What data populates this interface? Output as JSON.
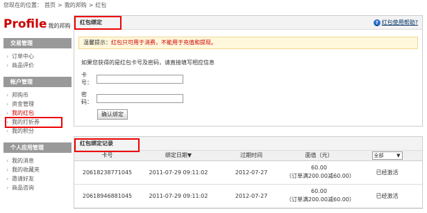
{
  "breadcrumb": {
    "prefix": "您现在的位置：",
    "items": [
      "首页",
      "我的邦购",
      "红包"
    ],
    "separator": ">"
  },
  "sidebar": {
    "title": "Profile",
    "subtitle": "我的邦购",
    "sections": [
      {
        "heading": "交易管理",
        "items": [
          "订单中心",
          "商品评价"
        ]
      },
      {
        "heading": "帐户管理",
        "items": [
          "邦购币",
          "资金管理",
          "我的红包",
          "我的打折券",
          "我的积分"
        ]
      },
      {
        "heading": "个人应用管理",
        "items": [
          "我的消息",
          "我的收藏夹",
          "邀请好友",
          "商品咨询"
        ]
      }
    ],
    "active_item": "我的红包"
  },
  "bind_panel": {
    "title": "红包绑定",
    "help_label": "红包使用帮助?",
    "notice_label": "温馨提示：",
    "notice_text": "红包只可用于消费，不能用于充值和提现。",
    "intro": "如果您获得的是红包卡号及密码，请直接填写相应信息",
    "card_label": "卡号：",
    "card_value": "",
    "password_label": "密码：",
    "password_value": "",
    "confirm_label": "确认绑定"
  },
  "records_panel": {
    "title": "红包绑定记录",
    "columns": [
      "卡号",
      "绑定日期▼",
      "过期时间",
      "面值（元）"
    ],
    "filter_value": "全部",
    "rows": [
      {
        "card": "20618238771045",
        "bind_date": "2011-07-29 09:11:02",
        "expire": "2012-07-27",
        "amount": "60.00",
        "condition": "（订单满200.00减60.00）",
        "status": "已经激活"
      },
      {
        "card": "20618946881045",
        "bind_date": "2011-07-29 09:11:02",
        "expire": "2012-07-27",
        "amount": "60.00",
        "condition": "（订单满200.00减60.00）",
        "status": "已经激活"
      }
    ]
  },
  "colors": {
    "accent_red": "#cc0000",
    "highlight_box": "#ee0000",
    "sidebar_header": "#999999",
    "notice_bg": "#fff8dc"
  }
}
